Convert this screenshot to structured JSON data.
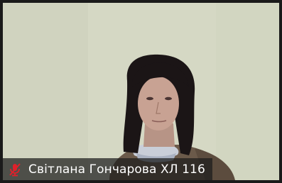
{
  "participant": {
    "name": "Світлана Гончарова ХЛ 116",
    "mic_state_icon": "muted-microphone-icon"
  },
  "colors": {
    "mic_muted": "#e0202a",
    "name_bar_bg": "#1c1c1c",
    "name_text": "#ffffff",
    "frame": "#1a1a1a",
    "wall": "#d6d9c6"
  }
}
